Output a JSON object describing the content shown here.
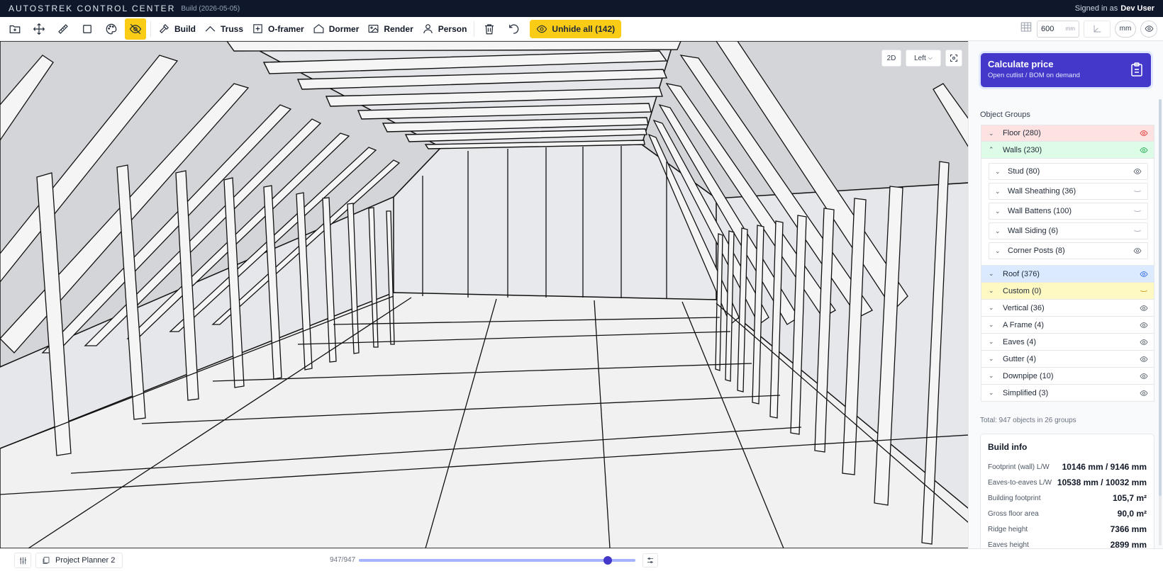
{
  "titlebar": {
    "app_title": "AUTOSTREK CONTROL CENTER",
    "build": "Build (2026-05-05)",
    "signed_in_prefix": "Signed in as",
    "user": "Dev User"
  },
  "toolbar": {
    "build_label": "Build",
    "truss_label": "Truss",
    "oframer_label": "O-framer",
    "dormer_label": "Dormer",
    "render_label": "Render",
    "person_label": "Person",
    "unhide_label": "Unhide all (142)",
    "grid_size_value": "600",
    "grid_size_unit": "mm",
    "units_label": "mm",
    "icons": [
      "folder-plus-icon",
      "move-icon",
      "ruler-icon",
      "square-icon",
      "palette-icon",
      "eye-off-icon",
      "hammer-icon",
      "truss-icon",
      "frame-icon",
      "house-icon",
      "image-icon",
      "person-icon",
      "trash-icon",
      "undo-icon",
      "eye-icon",
      "grid-icon",
      "axis-icon"
    ],
    "accent_color": "#facc15"
  },
  "viewport": {
    "mode_2d": "2D",
    "view_select": "Left"
  },
  "panel": {
    "calc_title": "Calculate price",
    "calc_subtitle": "Open cutlist / BOM on demand",
    "calc_color": "#4338ca",
    "object_groups_title": "Object Groups",
    "groups": {
      "floor": "Floor (280)",
      "walls": "Walls (230)",
      "roof": "Roof (376)",
      "custom": "Custom (0)",
      "vertical": "Vertical (36)",
      "aframe": "A Frame (4)",
      "eaves": "Eaves (4)",
      "gutter": "Gutter (4)",
      "downpipe": "Downpipe (10)",
      "simplified": "Simplified (3)"
    },
    "wall_subgroups": {
      "stud": "Stud (80)",
      "sheathing": "Wall Sheathing (36)",
      "battens": "Wall Battens (100)",
      "siding": "Wall Siding (6)",
      "corner_posts": "Corner Posts (8)"
    },
    "total": "Total: 947 objects in 26 groups",
    "build_info": {
      "title": "Build info",
      "footprint_label": "Footprint (wall) L/W",
      "footprint_value": "10146 mm / 9146 mm",
      "eaves_label": "Eaves-to-eaves L/W",
      "eaves_value": "10538 mm / 10032 mm",
      "building_footprint_label": "Building footprint",
      "building_footprint_value": "105,7 m²",
      "gross_label": "Gross floor area",
      "gross_value": "90,0 m²",
      "ridge_label": "Ridge height",
      "ridge_value": "7366 mm",
      "eaves_height_label": "Eaves height",
      "eaves_height_value": "2899 mm"
    }
  },
  "bottombar": {
    "project_name": "Project Planner 2",
    "visible_count": "947/947",
    "visible_fraction": 1.0
  }
}
